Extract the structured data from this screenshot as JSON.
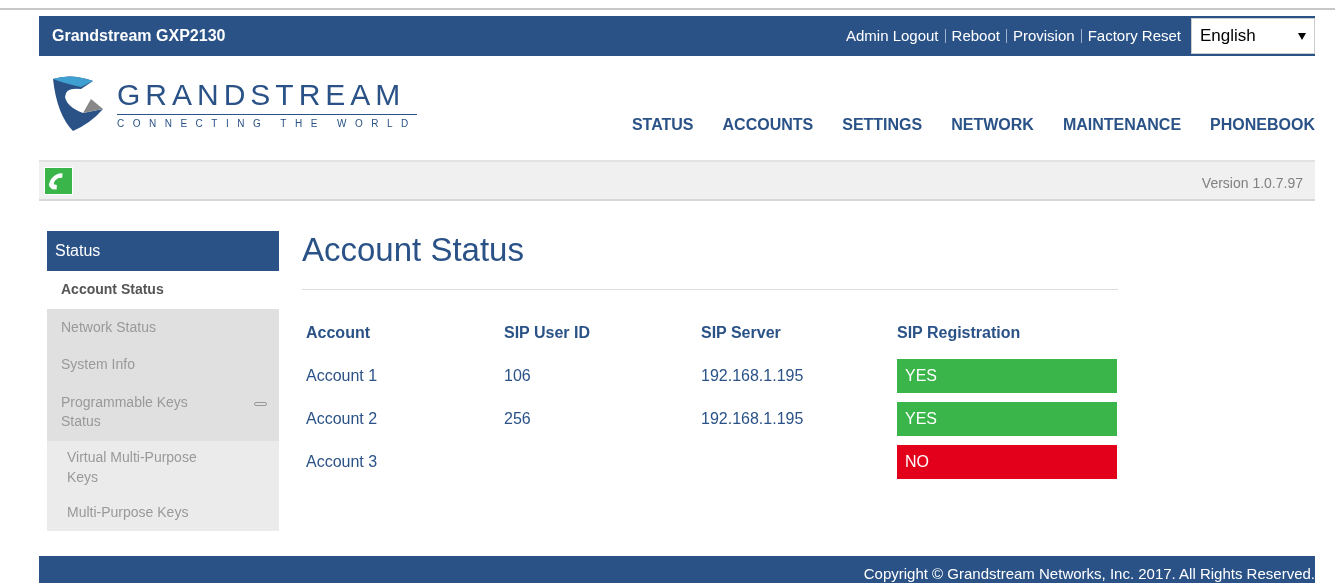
{
  "header": {
    "title": "Grandstream GXP2130",
    "links": [
      "Admin Logout",
      "Reboot",
      "Provision",
      "Factory Reset"
    ],
    "language": "English"
  },
  "logo": {
    "name": "GRANDSTREAM",
    "tagline": "CONNECTING THE WORLD"
  },
  "nav": [
    "STATUS",
    "ACCOUNTS",
    "SETTINGS",
    "NETWORK",
    "MAINTENANCE",
    "PHONEBOOK"
  ],
  "version": "Version 1.0.7.97",
  "sidebar": {
    "section": "Status",
    "items": [
      {
        "label": "Account Status",
        "selected": true
      },
      {
        "label": "Network Status",
        "selected": false
      },
      {
        "label": "System Info",
        "selected": false
      },
      {
        "label": "Programmable Keys Status",
        "selected": false,
        "expanded": true,
        "children": [
          {
            "label": "Virtual Multi-Purpose Keys",
            "selected": false
          },
          {
            "label": "Multi-Purpose Keys",
            "selected": false
          }
        ]
      }
    ]
  },
  "page_title": "Account Status",
  "table": {
    "columns": [
      "Account",
      "SIP User ID",
      "SIP Server",
      "SIP Registration"
    ],
    "rows": [
      {
        "account": "Account 1",
        "user_id": "106",
        "server": "192.168.1.195",
        "registration": "YES",
        "registered": true
      },
      {
        "account": "Account 2",
        "user_id": "256",
        "server": "192.168.1.195",
        "registration": "YES",
        "registered": true
      },
      {
        "account": "Account 3",
        "registration": "NO",
        "registered": false
      }
    ]
  },
  "footer": "Copyright © Grandstream Networks, Inc. 2017. All Rights Reserved."
}
